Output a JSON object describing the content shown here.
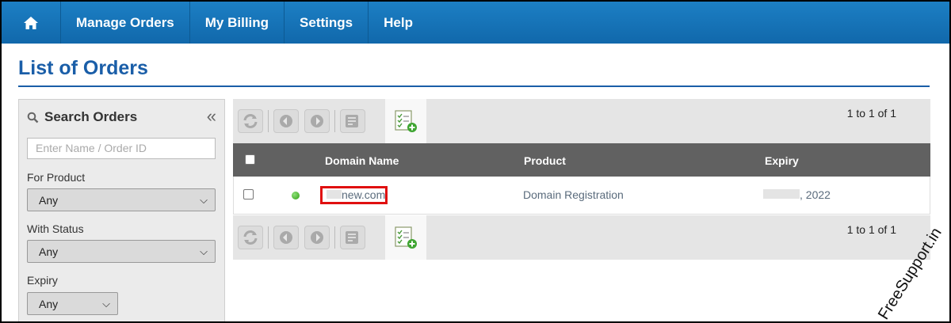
{
  "nav": {
    "home_icon": "home-icon",
    "items": [
      "Manage Orders",
      "My Billing",
      "Settings",
      "Help"
    ]
  },
  "page": {
    "title": "List of Orders"
  },
  "search": {
    "title": "Search Orders",
    "collapse_glyph": "«",
    "placeholder": "Enter Name / Order ID",
    "product_label": "For Product",
    "product_value": "Any",
    "status_label": "With Status",
    "status_value": "Any",
    "expiry_label": "Expiry",
    "expiry_value": "Any"
  },
  "toolbar": {
    "icons": [
      "refresh-icon",
      "suspend-icon",
      "unsuspend-icon",
      "edit-list-icon",
      "add-order-icon"
    ],
    "pager_text": "1 to 1 of 1"
  },
  "table": {
    "columns": [
      "Domain Name",
      "Product",
      "Expiry"
    ],
    "rows": [
      {
        "domain": "new.com",
        "product": "Domain Registration",
        "expiry": ", 2022",
        "status_color": "#3cb521"
      }
    ]
  },
  "watermark": "FreeSupport.in",
  "colors": {
    "nav": "#1572b8",
    "title": "#1a5ea8",
    "table_header": "#616161",
    "highlight": "#e01010"
  }
}
